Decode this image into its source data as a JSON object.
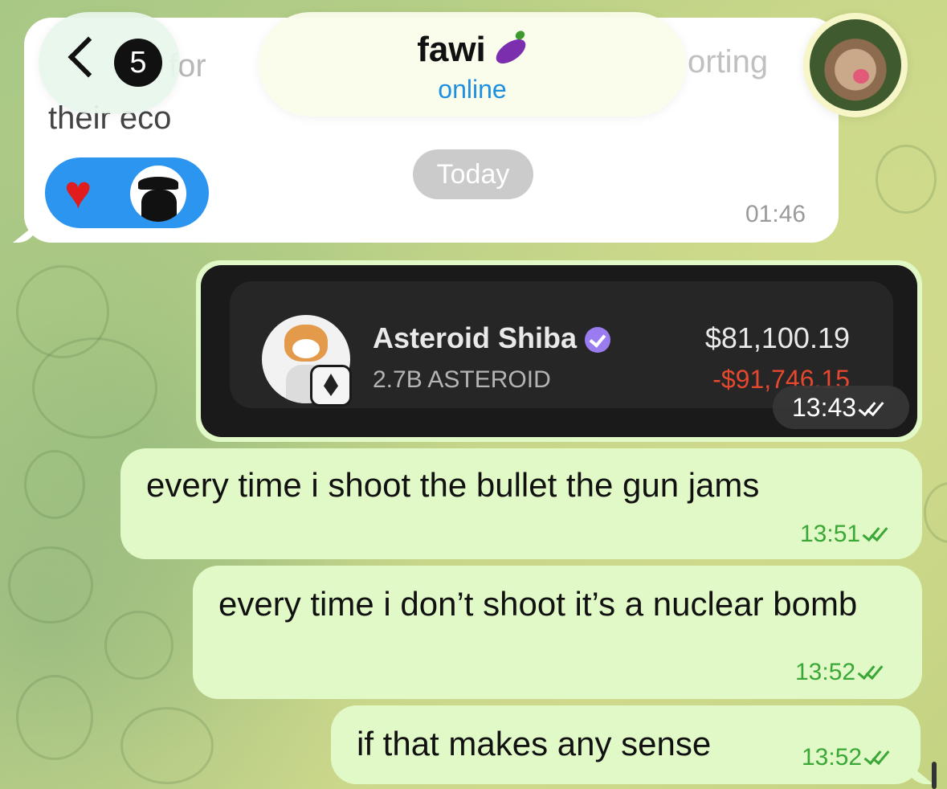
{
  "header": {
    "back_count": "5",
    "contact_name": "fawi",
    "status": "online"
  },
  "previous_message": {
    "visible_fragment_1": "for",
    "visible_fragment_2": "orting",
    "visible_fragment_3": "their eco",
    "time": "01:46",
    "reactions": [
      "heart",
      "spy-avatar"
    ]
  },
  "date_separator": "Today",
  "token_card": {
    "name": "Asteroid Shiba",
    "amount": "2.7B ASTEROID",
    "price": "$81,100.19",
    "change": "-$91,746.15",
    "time": "13:43"
  },
  "messages": [
    {
      "text": "every time i shoot the bullet the gun jams",
      "time": "13:51"
    },
    {
      "text": "every time i don’t shoot it’s a nuclear bomb",
      "time": "13:52"
    },
    {
      "text": "if that makes any sense",
      "time": "13:52"
    }
  ],
  "colors": {
    "outgoing_bubble": "#e0f9c6",
    "incoming_bubble": "#ffffff",
    "accent_blue": "#1f8fe0",
    "read_check_green": "#3aa736",
    "negative_red": "#e5472f",
    "verified_purple": "#9a7cf0"
  }
}
